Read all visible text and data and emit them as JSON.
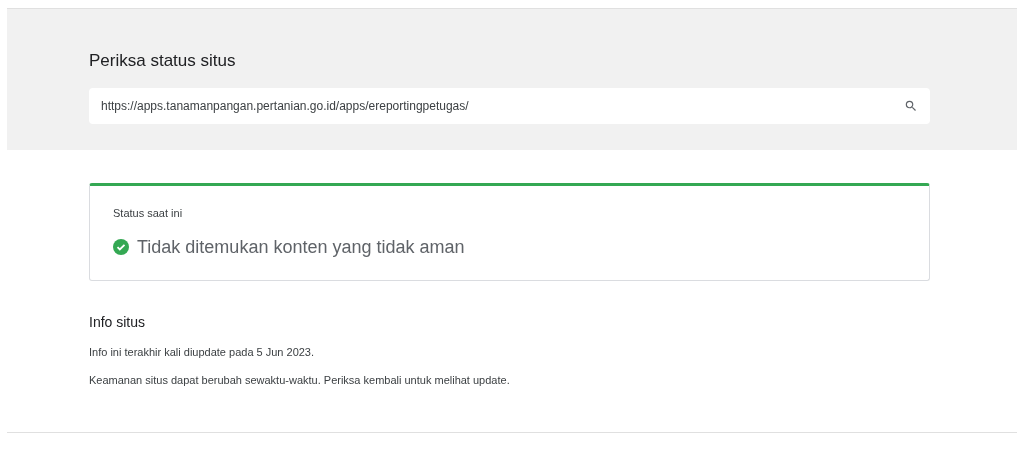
{
  "search": {
    "title": "Periksa status situs",
    "value": "https://apps.tanamanpangan.pertanian.go.id/apps/ereportingpetugas/"
  },
  "status": {
    "label": "Status saat ini",
    "result": "Tidak ditemukan konten yang tidak aman",
    "safe": true
  },
  "info": {
    "title": "Info situs",
    "lines": [
      "Info ini terakhir kali diupdate pada 5 Jun 2023.",
      "Keamanan situs dapat berubah sewaktu-waktu. Periksa kembali untuk melihat update."
    ]
  }
}
